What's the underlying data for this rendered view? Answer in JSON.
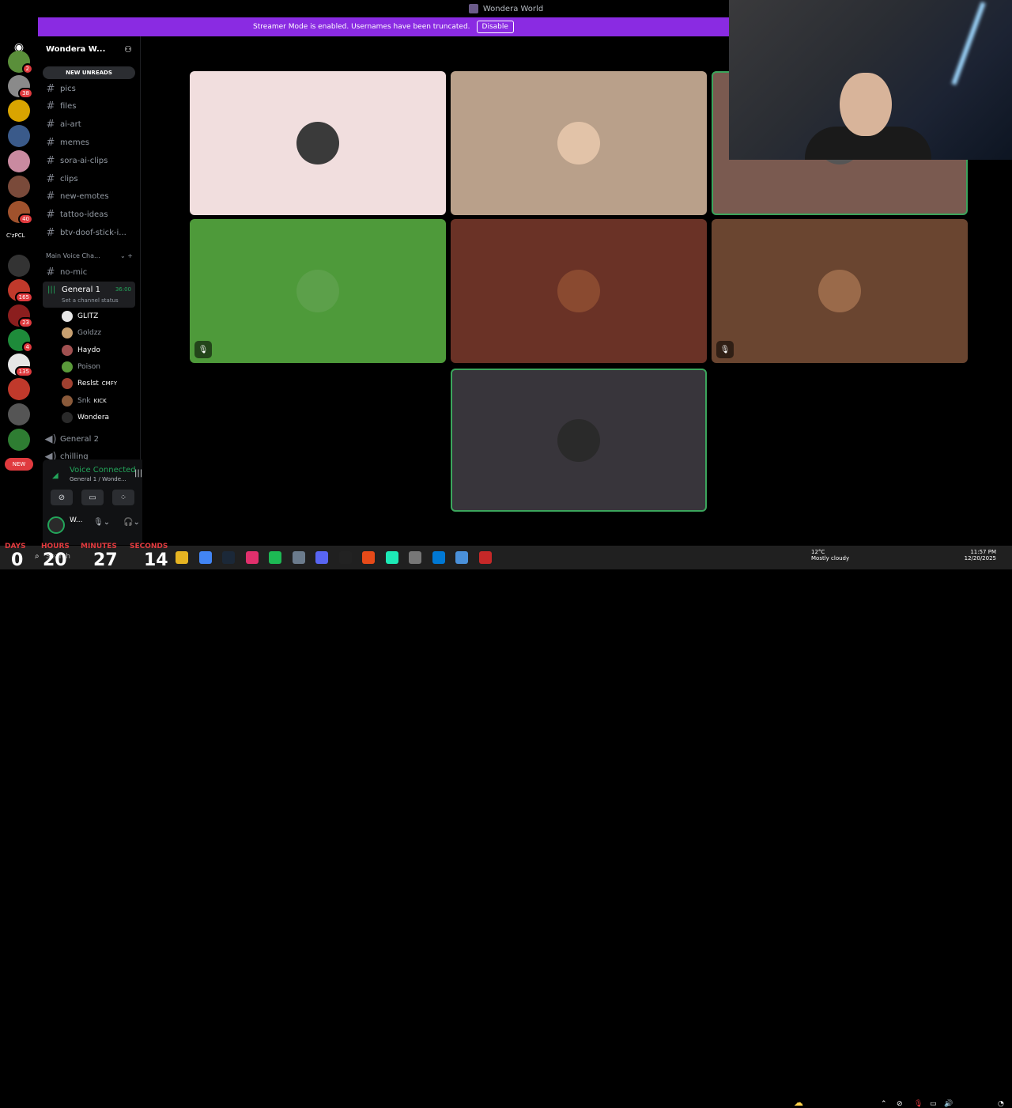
{
  "window": {
    "title": "Wondera World"
  },
  "banner": {
    "text": "Streamer Mode is enabled. Usernames have been truncated.",
    "button": "Disable"
  },
  "servers": [
    {
      "badge": "2",
      "color": "#5a8f3a"
    },
    {
      "badge": "38",
      "color": "#8a8a8a"
    },
    {
      "badge": "",
      "color": "#d9a400"
    },
    {
      "badge": "",
      "color": "#3a5a8a"
    },
    {
      "badge": "",
      "color": "#c98aa0"
    },
    {
      "badge": "",
      "color": "#7a4a3a"
    },
    {
      "badge": "40",
      "color": "#a0522d"
    },
    {
      "badge": "",
      "color": "#333333"
    },
    {
      "badge": "165",
      "color": "#c0392b"
    },
    {
      "badge": "23",
      "color": "#8b1e1e"
    },
    {
      "badge": "4",
      "color": "#1e8b3a"
    },
    {
      "badge": "135",
      "color": "#e6e6e6"
    },
    {
      "badge": "",
      "color": "#c0392b"
    },
    {
      "badge": "",
      "color": "#555555"
    },
    {
      "badge": "",
      "color": "#2e7d32"
    }
  ],
  "server_label_text": "C'zPCL",
  "new_pill": "NEW",
  "server_name": "Wondera W...",
  "new_unreads": "NEW UNREADS",
  "channels": [
    "pics",
    "files",
    "ai-art",
    "memes",
    "sora-ai-clips",
    "clips",
    "new-emotes",
    "tattoo-ideas",
    "btv-doof-stick-i..."
  ],
  "category": "Main Voice Cha...",
  "no_mic": "no-mic",
  "voice_active": {
    "name": "General 1",
    "time": "36:00",
    "status": "Set a channel status"
  },
  "voice_users": [
    {
      "name": "GLITZ",
      "tag": "",
      "bright": true,
      "color": "#e6e6e6"
    },
    {
      "name": "Goldzz",
      "tag": "",
      "bright": false,
      "color": "#c8a070"
    },
    {
      "name": "Haydo",
      "tag": "",
      "bright": true,
      "color": "#a05050"
    },
    {
      "name": "Poison",
      "tag": "",
      "bright": false,
      "color": "#5a9a3a"
    },
    {
      "name": "Reslst",
      "tag": "CMFY",
      "bright": true,
      "color": "#a04030"
    },
    {
      "name": "Snk",
      "tag": "KICK",
      "bright": false,
      "color": "#8a5a3a"
    },
    {
      "name": "Wondera",
      "tag": "",
      "bright": true,
      "color": "#2a2a2a"
    }
  ],
  "other_voice": [
    "General 2",
    "chilling"
  ],
  "voice_panel": {
    "state": "Voice Connected",
    "channel": "General 1 / Wonde..."
  },
  "me": {
    "name": "W..."
  },
  "tiles": [
    {
      "bg": "#f1dede",
      "avatar": "#3a3a3a",
      "mute": false,
      "border": false
    },
    {
      "bg": "#b9a08a",
      "avatar": "#e2c3a8",
      "mute": false,
      "border": false
    },
    {
      "bg": "#7a5a50",
      "avatar": "#555555",
      "mute": false,
      "border": true
    },
    {
      "bg": "#4e9a3a",
      "avatar": "#5ca04a",
      "mute": true,
      "border": false
    },
    {
      "bg": "#6a3226",
      "avatar": "#8a4a30",
      "mute": false,
      "border": false
    },
    {
      "bg": "#6a4530",
      "avatar": "#9a6a4a",
      "mute": true,
      "border": false
    },
    {
      "bg": "#38353b",
      "avatar": "#2a2a2a",
      "mute": false,
      "border": true
    }
  ],
  "countdown": {
    "labels": [
      "DAYS",
      "HOURS",
      "MINUTES",
      "SECONDS"
    ],
    "values": [
      "0",
      "20",
      "27",
      "14"
    ]
  },
  "taskbar": {
    "search": "Search"
  },
  "weather": {
    "temp": "12°C",
    "desc": "Mostly cloudy"
  },
  "clock": {
    "time": "11:57 PM",
    "date": "12/20/2025"
  }
}
